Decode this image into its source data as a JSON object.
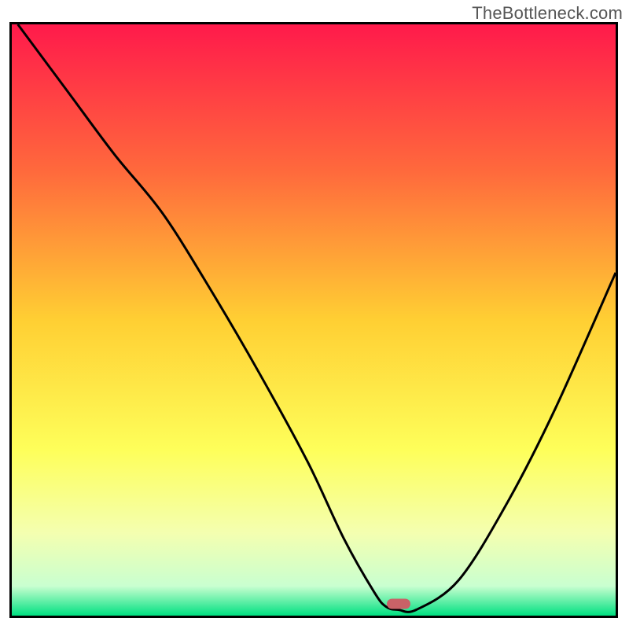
{
  "watermark": "TheBottleneck.com",
  "chart_data": {
    "type": "line",
    "title": "",
    "xlabel": "",
    "ylabel": "",
    "xlim": [
      0,
      100
    ],
    "ylim": [
      0,
      100
    ],
    "grid": false,
    "legend": false,
    "gradient_stops": [
      {
        "offset": 0,
        "color": "#ff1a4b"
      },
      {
        "offset": 25,
        "color": "#ff6a3c"
      },
      {
        "offset": 50,
        "color": "#ffcf33"
      },
      {
        "offset": 72,
        "color": "#feff5a"
      },
      {
        "offset": 86,
        "color": "#f4ffb0"
      },
      {
        "offset": 95,
        "color": "#c9ffd0"
      },
      {
        "offset": 100,
        "color": "#00e081"
      }
    ],
    "series": [
      {
        "name": "bottleneck-curve",
        "color": "#000000",
        "x": [
          1,
          9,
          17,
          25,
          33,
          41,
          49,
          55,
          60,
          62,
          64,
          67,
          74,
          82,
          90,
          100
        ],
        "y": [
          100,
          89,
          78,
          68,
          55,
          41,
          26,
          13,
          4,
          1.5,
          1,
          1,
          6,
          19,
          35,
          58
        ]
      }
    ],
    "marker": {
      "x": 64,
      "y": 2,
      "color": "#c96267"
    }
  }
}
